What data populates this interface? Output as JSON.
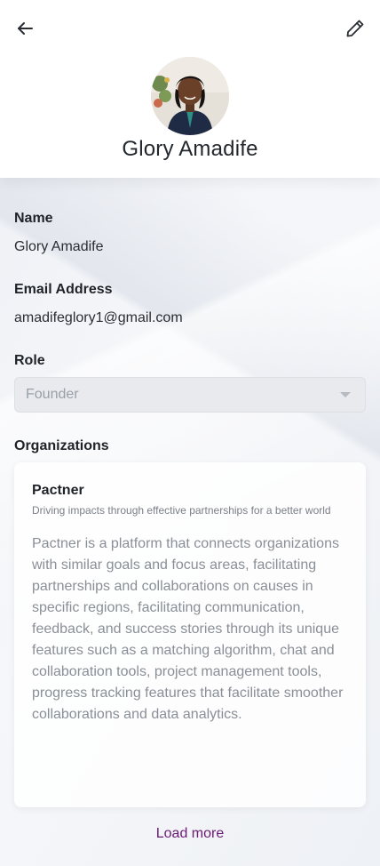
{
  "profile": {
    "name": "Glory Amadife",
    "avatar_alt": "profile photo"
  },
  "header": {
    "back_icon": "arrow-left-icon",
    "edit_icon": "pencil-icon"
  },
  "fields": {
    "name_label": "Name",
    "name_value": "Glory Amadife",
    "email_label": "Email Address",
    "email_value": "amadifeglory1@gmail.com",
    "role_label": "Role",
    "role_value": "Founder"
  },
  "organizations": {
    "label": "Organizations",
    "items": [
      {
        "name": "Pactner",
        "tagline": "Driving impacts through effective partnerships for a better world",
        "description": "Pactner is a platform that connects organizations with similar goals and focus areas, facilitating partnerships and collaborations on causes in specific regions, facilitating communication, feedback, and success stories through its unique features such as a matching algorithm, chat and collaboration tools, project management tools, progress tracking features that facilitate smoother collaborations and data analytics."
      }
    ],
    "load_more_label": "Load more"
  },
  "colors": {
    "accent": "#6b1a74",
    "background": "#f1f3f7",
    "card": "#ffffff",
    "select_bg": "#e8eaee"
  }
}
